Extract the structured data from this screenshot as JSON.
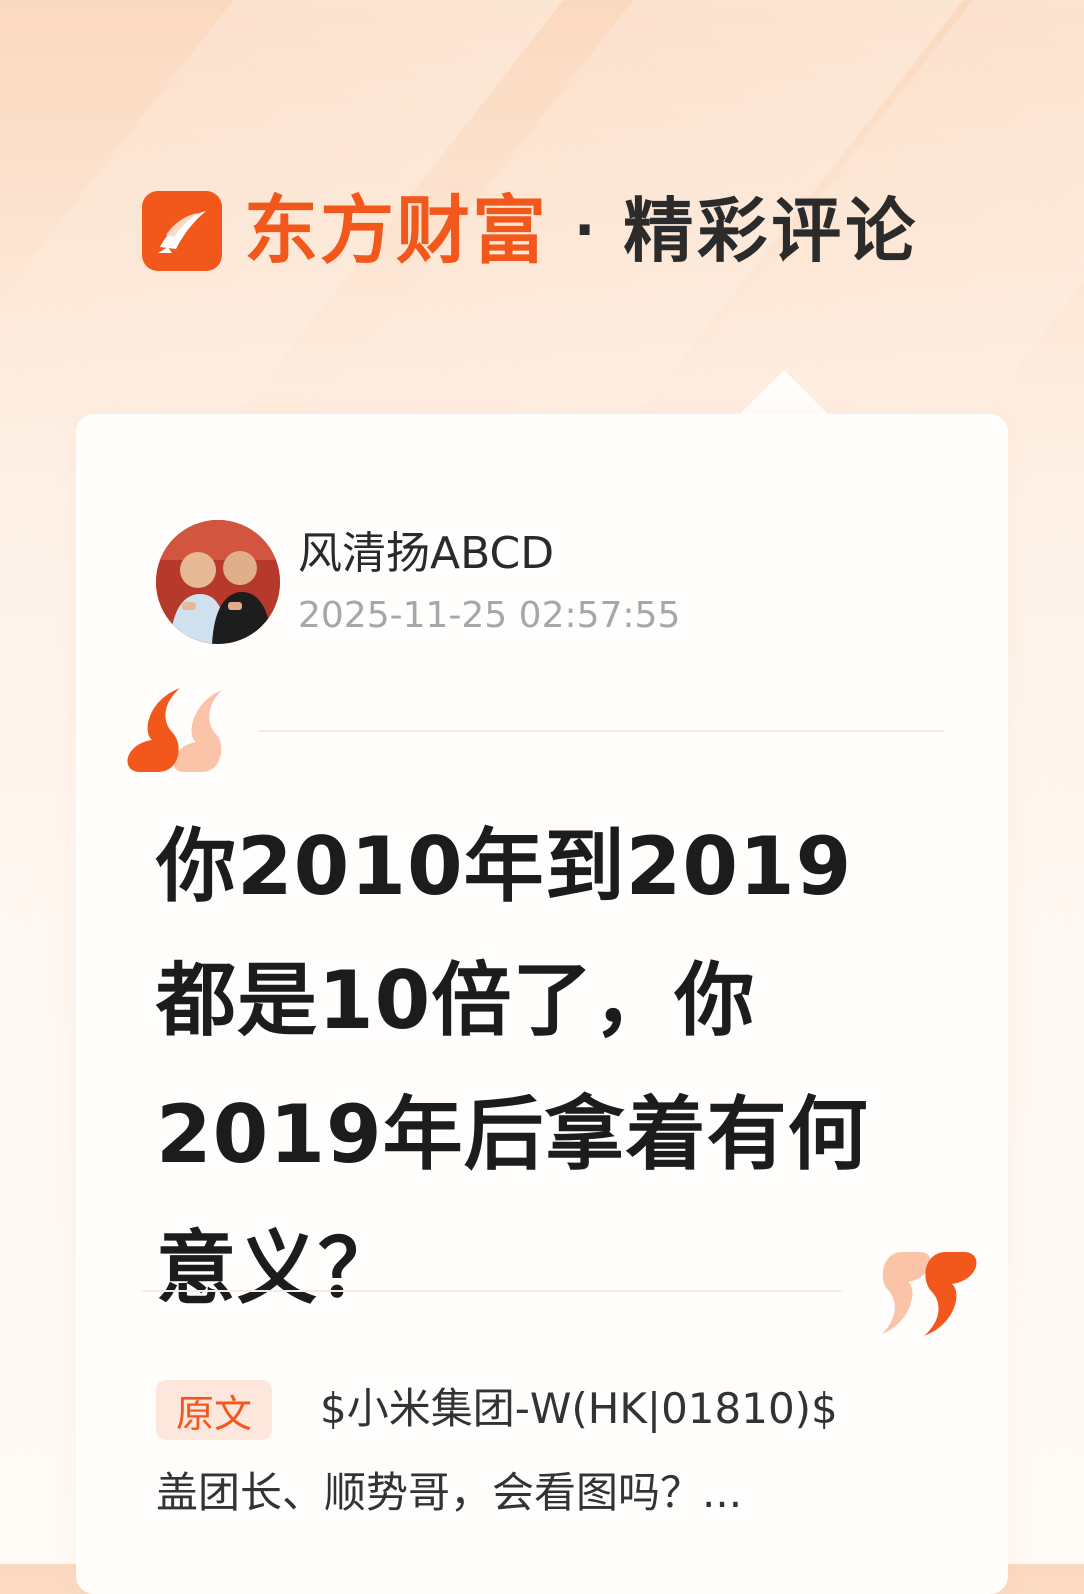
{
  "header": {
    "logo_icon": "eastmoney-logo-icon",
    "brand": "东方财富",
    "separator": "·",
    "section": "精彩评论"
  },
  "post": {
    "avatar_icon": "user-avatar",
    "username": "风清扬ABCD",
    "timestamp": "2025-11-25 02:57:55",
    "comment": "你2010年到2019都是10倍了，你2019年后拿着有何意义？"
  },
  "original": {
    "badge": "原文",
    "line1": "$小米集团-W(HK|01810)$",
    "line2": "盖团长、顺势哥，会看图吗？..."
  },
  "colors": {
    "brand": "#f2571c",
    "quote_light": "#fbc3a8"
  }
}
